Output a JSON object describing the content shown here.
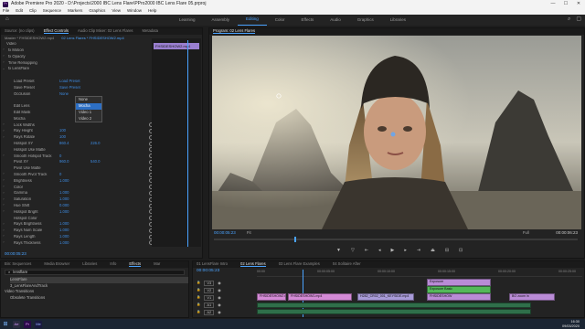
{
  "titlebar": {
    "title": "Adobe Premiere Pro 2020 - D:\\Projects\\2000 IBC Lens Flare\\PPro2000 IBC Lens Flare 05.prproj",
    "logo": "Pr"
  },
  "window_controls": {
    "minimize": "—",
    "maximize": "☐",
    "close": "✕"
  },
  "menu": [
    "File",
    "Edit",
    "Clip",
    "Sequence",
    "Markers",
    "Graphics",
    "View",
    "Window",
    "Help"
  ],
  "workspaces": {
    "items": [
      "Learning",
      "Assembly",
      "Editing",
      "Color",
      "Effects",
      "Audio",
      "Graphics",
      "Libraries"
    ],
    "active": "Editing"
  },
  "source_tabs": [
    "Source: (no clips)",
    "Effect Controls",
    "Audio Clip Mixer: 02 Lens Flares",
    "Metadata"
  ],
  "ec": {
    "master": "Master * FHSIDESHOW2.mp4",
    "seq": "02 Lens Flares * FHSIDESHOW2.mp4",
    "mini_clip": "FHSIDESHOW2.mp4",
    "rows": [
      {
        "c": "",
        "l": "Video",
        "v": "",
        "v2": ""
      },
      {
        "c": "›",
        "l": "fx Motion",
        "v": "",
        "v2": ""
      },
      {
        "c": "›",
        "l": "fx Opacity",
        "v": "",
        "v2": ""
      },
      {
        "c": "›",
        "l": "Time Remapping",
        "v": "",
        "v2": ""
      },
      {
        "c": "⌄",
        "l": "fx LensFlare",
        "v": "",
        "v2": ""
      },
      {
        "c": "",
        "l": "",
        "v": "",
        "v2": ""
      },
      {
        "c": "",
        "l": "Load Preset",
        "v": "Load Preset",
        "v2": ""
      },
      {
        "c": "",
        "l": "Save Preset",
        "v": "Save Preset",
        "v2": ""
      },
      {
        "c": "",
        "l": "Occlusion",
        "v": "None",
        "v2": ""
      },
      {
        "c": "",
        "l": "",
        "v": "",
        "v2": ""
      },
      {
        "c": "",
        "l": "Edit Lens",
        "v": "",
        "v2": ""
      },
      {
        "c": "",
        "l": "Edit Mask",
        "v": "",
        "v2": ""
      },
      {
        "c": "",
        "l": "Mocha",
        "v": "",
        "v2": ""
      },
      {
        "c": "›",
        "l": "Lock Widths",
        "v": "",
        "v2": ""
      },
      {
        "c": "›",
        "l": "Ray Height",
        "v": "100",
        "v2": ""
      },
      {
        "c": "›",
        "l": "Rays Rotate",
        "v": "100",
        "v2": ""
      },
      {
        "c": "",
        "l": "Hotspot XY",
        "v": "860.4",
        "v2": "226.0"
      },
      {
        "c": "",
        "l": "Hotspot Use Matte",
        "v": "",
        "v2": ""
      },
      {
        "c": "›",
        "l": "Smooth Hotspot Track",
        "v": "0",
        "v2": ""
      },
      {
        "c": "",
        "l": "Pivot XY",
        "v": "960.0",
        "v2": "540.0"
      },
      {
        "c": "",
        "l": "Pivot Use Matte",
        "v": "",
        "v2": ""
      },
      {
        "c": "›",
        "l": "Smooth Pivot Track",
        "v": "0",
        "v2": ""
      },
      {
        "c": "›",
        "l": "Brightness",
        "v": "1.000",
        "v2": ""
      },
      {
        "c": "›",
        "l": "Color",
        "v": "",
        "v2": ""
      },
      {
        "c": "›",
        "l": "Gamma",
        "v": "1.000",
        "v2": ""
      },
      {
        "c": "›",
        "l": "Saturation",
        "v": "1.000",
        "v2": ""
      },
      {
        "c": "›",
        "l": "Hue Shift",
        "v": "0.000",
        "v2": ""
      },
      {
        "c": "›",
        "l": "Hotspot Bright",
        "v": "1.000",
        "v2": ""
      },
      {
        "c": "",
        "l": "Hotspot Color",
        "v": "",
        "v2": ""
      },
      {
        "c": "›",
        "l": "Rays Brightness",
        "v": "1.000",
        "v2": ""
      },
      {
        "c": "›",
        "l": "Rays Num Scale",
        "v": "1.000",
        "v2": ""
      },
      {
        "c": "›",
        "l": "Rays Length",
        "v": "1.000",
        "v2": ""
      },
      {
        "c": "›",
        "l": "Rays Thickness",
        "v": "1.000",
        "v2": ""
      }
    ],
    "dropdown": [
      "None",
      "Mocha",
      "Video 1",
      "Video 2"
    ],
    "dropdown_selected": "Mocha",
    "timecode": "00:00:05:23"
  },
  "program": {
    "tab": "Program: 02 Lens Flares",
    "timecode": "00:00:05:23",
    "fit": "Fit",
    "quality": "Full",
    "duration": "00:00:06:23"
  },
  "project": {
    "tabs": [
      "Bin: Sequences",
      "Media Browser",
      "Libraries",
      "Info",
      "Effects",
      "Mar"
    ],
    "search": "lensflare",
    "items": [
      "LensFlare",
      "3_LensFlareAndTrack",
      "Video Transitions",
      "Obsolete Transitions"
    ]
  },
  "timeline": {
    "tabs": [
      "01 LensFlare Intro",
      "02 Lens Flares",
      "03 Lens Flare Examples",
      "04 Solitaire After"
    ],
    "timecode": "00:00:05:23",
    "ruler": [
      "00:00",
      "00:00:05:00",
      "00:00:10:00",
      "00:00:15:00",
      "00:00:20:00",
      "00:00:25:00"
    ],
    "tracks": [
      "V3",
      "V2",
      "V1",
      "A1",
      "A2"
    ],
    "clips": [
      {
        "label": "Exposure",
        "color": "#b98bd6"
      },
      {
        "label": "Exposure Basic",
        "color": "#54b85a"
      },
      {
        "label": "FHSIDESHOW2 rep",
        "color": "#d48ad6"
      },
      {
        "label": "FHSIDESHOW1.mp4",
        "color": "#d48ad6"
      },
      {
        "label": "H282_CR02_001_KEYSIDE.mp4",
        "color": "#a89ad8"
      },
      {
        "label": "FHSIDESHOW",
        "color": "#b98bd6"
      },
      {
        "label": "BO zoom in",
        "color": "#b98bd6"
      }
    ]
  },
  "taskbar": {
    "time": "16:30",
    "date": "09/03/2020",
    "apps": [
      "Ae",
      "Pr",
      "Me"
    ]
  }
}
